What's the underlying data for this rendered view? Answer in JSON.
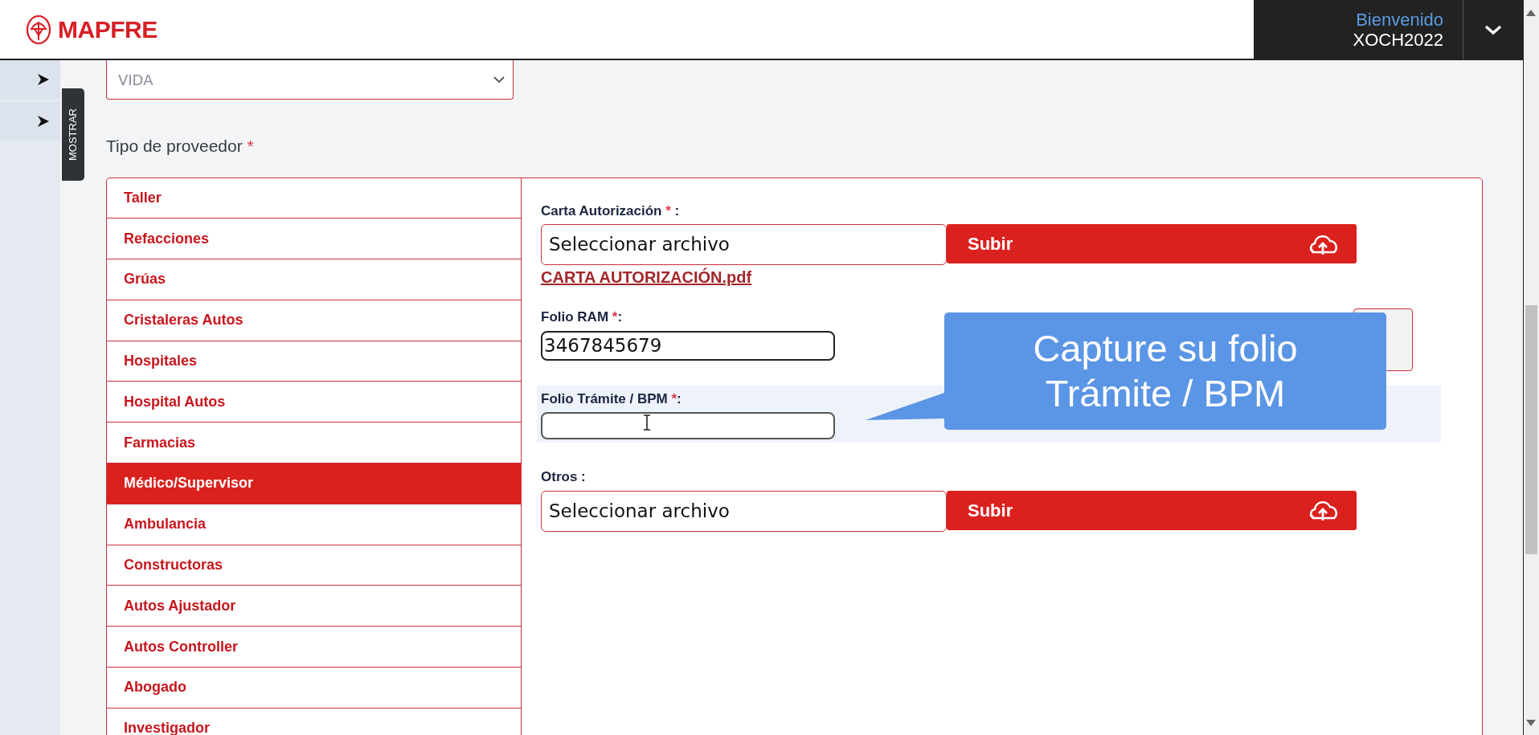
{
  "header": {
    "logo": "MAPFRE",
    "welcome": "Bienvenido",
    "user": "XOCH2022"
  },
  "sidebar_toggles": [
    {
      "expanded": false
    },
    {
      "expanded": false
    }
  ],
  "show_tab": "MOSTRAR",
  "ramo_select": {
    "value": "VIDA"
  },
  "provider_type": {
    "label": "Tipo de proveedor",
    "mark": "*",
    "options": [
      {
        "label": "Taller",
        "selected": false
      },
      {
        "label": "Refacciones",
        "selected": false
      },
      {
        "label": "Grúas",
        "selected": false
      },
      {
        "label": "Cristaleras Autos",
        "selected": false
      },
      {
        "label": "Hospitales",
        "selected": false
      },
      {
        "label": "Hospital Autos",
        "selected": false
      },
      {
        "label": "Farmacias",
        "selected": false
      },
      {
        "label": "Médico/Supervisor",
        "selected": true
      },
      {
        "label": "Ambulancia",
        "selected": false
      },
      {
        "label": "Constructoras",
        "selected": false
      },
      {
        "label": "Autos Ajustador",
        "selected": false
      },
      {
        "label": "Autos Controller",
        "selected": false
      },
      {
        "label": "Abogado",
        "selected": false
      },
      {
        "label": "Investigador",
        "selected": false
      }
    ]
  },
  "fields": [
    {
      "kind": "file",
      "label": "Carta Autorización",
      "mark": "*",
      "suffix": " :",
      "choose": "Seleccionar archivo",
      "upload": "Subir",
      "link": "CARTA AUTORIZACIÓN.pdf",
      "focused": false
    },
    {
      "kind": "text",
      "label": "Folio RAM",
      "mark": "*",
      "suffix": ":",
      "value": "3467845679",
      "focused": false
    },
    {
      "kind": "text",
      "label": "Folio Trámite / BPM",
      "mark": "*",
      "suffix": ":",
      "focused": true
    },
    {
      "kind": "file",
      "label": "Otros",
      "suffix": " :",
      "choose": "Seleccionar archivo",
      "upload": "Subir",
      "focused": false
    }
  ],
  "callout": {
    "text": "Capture su folio Trámite / BPM"
  }
}
